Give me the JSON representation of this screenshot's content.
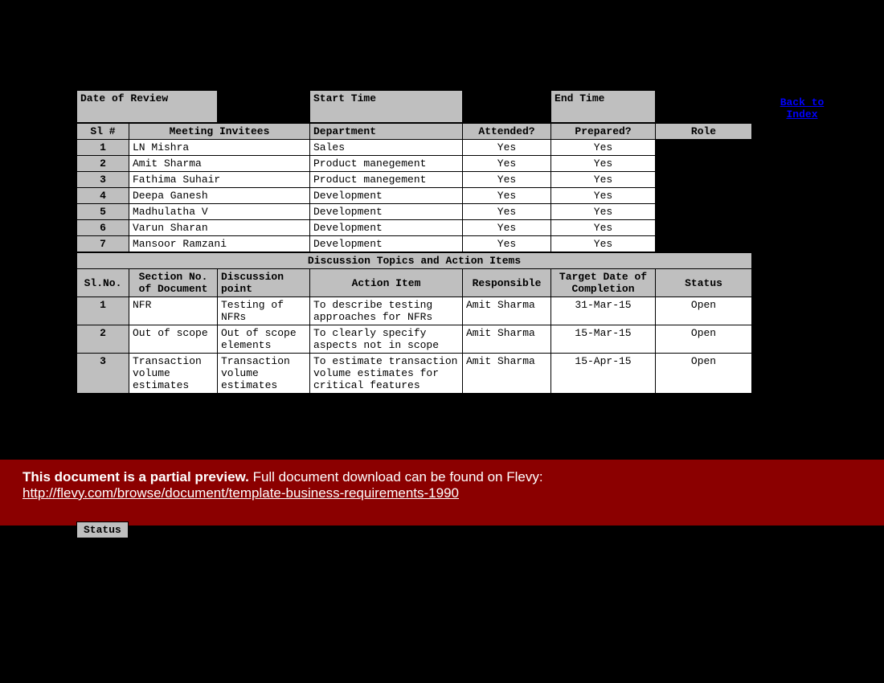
{
  "topband": {
    "date_label": "Date of Review",
    "start_label": "Start Time",
    "end_label": "End Time"
  },
  "invitees_header": {
    "sl": "Sl #",
    "name": "Meeting Invitees",
    "dept": "Department",
    "attended": "Attended?",
    "prepared": "Prepared?",
    "role": "Role"
  },
  "invitees": [
    {
      "n": "1",
      "name": "LN Mishra",
      "dept": "Sales",
      "att": "Yes",
      "prep": "Yes"
    },
    {
      "n": "2",
      "name": "Amit Sharma",
      "dept": "Product manegement",
      "att": "Yes",
      "prep": "Yes"
    },
    {
      "n": "3",
      "name": "Fathima Suhair",
      "dept": "Product manegement",
      "att": "Yes",
      "prep": "Yes"
    },
    {
      "n": "4",
      "name": "Deepa Ganesh",
      "dept": "Development",
      "att": "Yes",
      "prep": "Yes"
    },
    {
      "n": "5",
      "name": "Madhulatha V",
      "dept": "Development",
      "att": "Yes",
      "prep": "Yes"
    },
    {
      "n": "6",
      "name": "Varun Sharan",
      "dept": "Development",
      "att": "Yes",
      "prep": "Yes"
    },
    {
      "n": "7",
      "name": "Mansoor Ramzani",
      "dept": "Development",
      "att": "Yes",
      "prep": "Yes"
    }
  ],
  "actions_banner": "Discussion Topics and Action Items",
  "actions_header": {
    "sl": "Sl.No.",
    "section": "Section No. of Document",
    "point": "Discussion point",
    "action": "Action Item",
    "resp": "Responsible",
    "target": "Target Date of Completion",
    "status": "Status"
  },
  "actions": [
    {
      "n": "1",
      "section": "NFR",
      "point": "Testing of NFRs",
      "action": "To describe testing approaches for NFRs",
      "resp": "Amit Sharma",
      "target": "31-Mar-15",
      "status": "Open"
    },
    {
      "n": "2",
      "section": "Out of scope",
      "point": "Out of scope elements",
      "action": "To clearly specify aspects not in scope",
      "resp": "Amit Sharma",
      "target": "15-Mar-15",
      "status": "Open"
    },
    {
      "n": "3",
      "section": "Transaction volume estimates",
      "point": "Transaction volume estimates",
      "action": "To estimate transaction volume estimates for critical features",
      "resp": "Amit Sharma",
      "target": "15-Apr-15",
      "status": "Open"
    }
  ],
  "back_link": "Back to Index",
  "status_label": "Status",
  "banner": {
    "bold": "This document is a partial preview.",
    "rest": "  Full document download can be found on Flevy:",
    "url": "http://flevy.com/browse/document/template-business-requirements-1990"
  }
}
